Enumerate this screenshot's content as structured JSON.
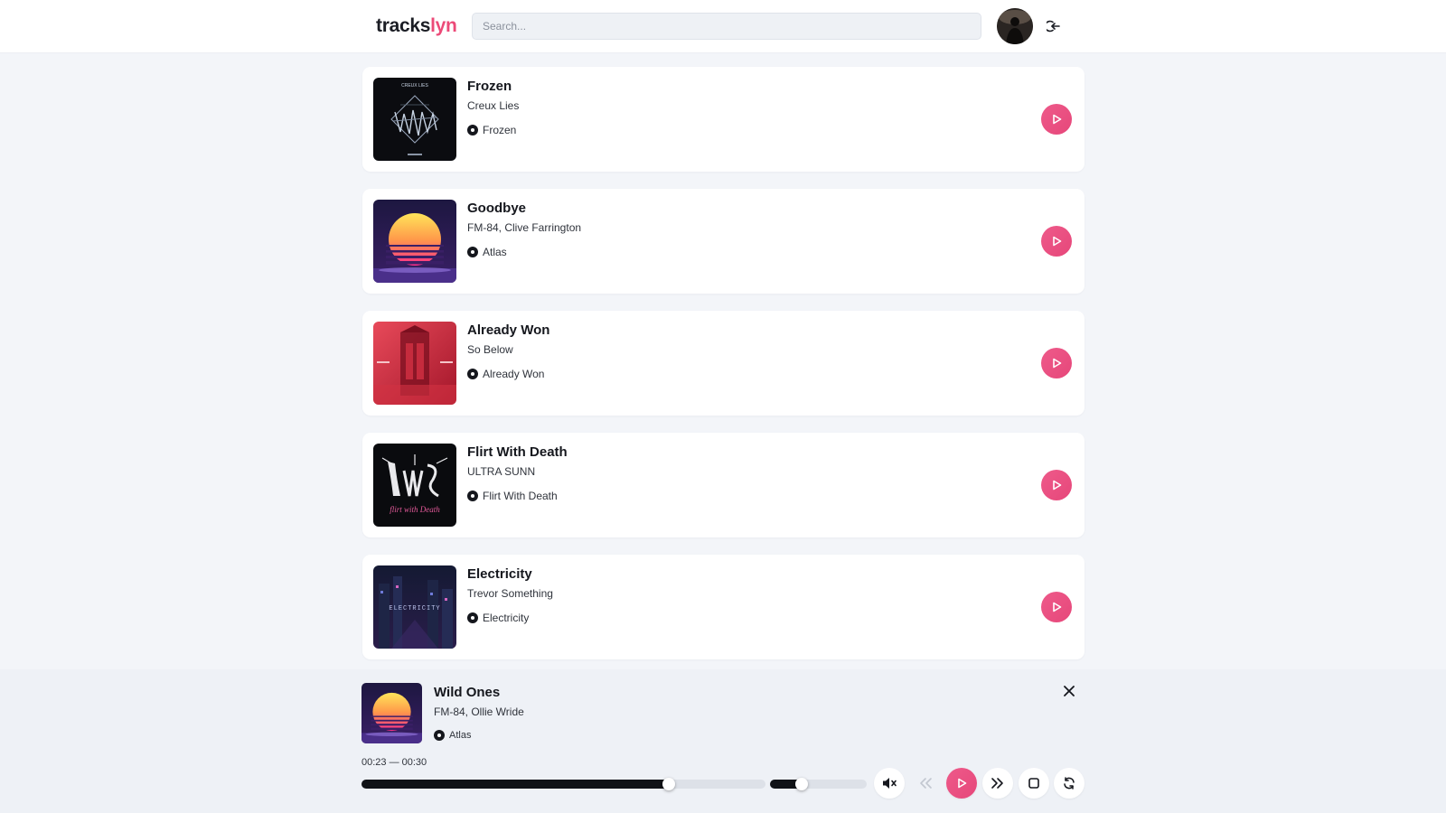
{
  "app": {
    "logo_part1": "tracks",
    "logo_part2": "lyn"
  },
  "search": {
    "placeholder": "Search...",
    "value": ""
  },
  "tracks": [
    {
      "title": "Frozen",
      "artist": "Creux Lies",
      "album": "Frozen",
      "cover_label": "CREUX LIES"
    },
    {
      "title": "Goodbye",
      "artist": "FM-84, Clive Farrington",
      "album": "Atlas"
    },
    {
      "title": "Already Won",
      "artist": "So Below",
      "album": "Already Won"
    },
    {
      "title": "Flirt With Death",
      "artist": "ULTRA SUNN",
      "album": "Flirt With Death",
      "cover_label": "flirt with Death"
    },
    {
      "title": "Electricity",
      "artist": "Trevor Something",
      "album": "Electricity",
      "cover_label": "ELECTRICITY"
    }
  ],
  "player": {
    "title": "Wild Ones",
    "artist": "FM-84, Ollie Wride",
    "album": "Atlas",
    "time": "00:23 — 00:30",
    "progress": 0.76,
    "volume": 0.33,
    "muted": true
  },
  "colors": {
    "accent": "#e94f7f",
    "background": "#f3f5f9",
    "dark": "#111317"
  },
  "icons": {
    "logout": "logout-icon",
    "play": "play-icon",
    "close": "close-icon",
    "mute": "volume-mute-icon",
    "previous": "rewind-icon",
    "next": "fast-forward-icon",
    "stop": "stop-icon",
    "repeat": "repeat-icon",
    "album": "disc-icon"
  }
}
